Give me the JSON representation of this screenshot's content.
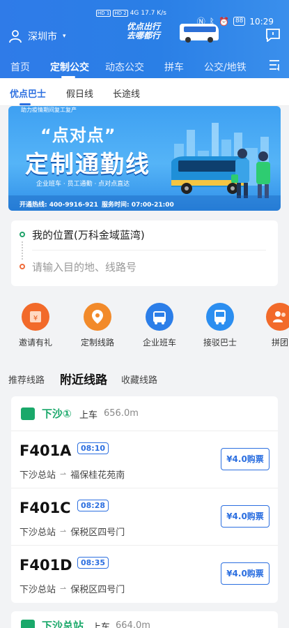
{
  "statusbar": {
    "sim1": "HD 1",
    "sim2": "HD 2",
    "net": "4G",
    "speed": "17.7 K/s",
    "battery": "88",
    "time": "10:29"
  },
  "header": {
    "city": "深圳市",
    "slogan_line1": "优点出行",
    "slogan_line2": "去哪都行"
  },
  "nav": {
    "tabs": [
      "首页",
      "定制公交",
      "动态公交",
      "拼车",
      "公交/地铁"
    ],
    "active": "定制公交"
  },
  "subtabs": {
    "items": [
      "优点巴士",
      "假日线",
      "长途线"
    ],
    "active": "优点巴士"
  },
  "hero": {
    "top_note": "助力疫情期间复工复产",
    "title1": "“点对点”",
    "title2": "定制通勤线",
    "tags": "企业班车 · 员工通勤 · 点对点直达",
    "hotline": "开通热线: 400-9916-921",
    "hours": "服务时间: 07:00-21:00"
  },
  "search": {
    "from": "我的位置(万科金域蓝湾)",
    "to_placeholder": "请输入目的地、线路号"
  },
  "quick": [
    {
      "label": "邀请有礼",
      "icon": "gift-icon",
      "color": "#f26a2a"
    },
    {
      "label": "定制线路",
      "icon": "map-pin-icon",
      "color": "#f28a2a"
    },
    {
      "label": "企业班车",
      "icon": "company-bus-icon",
      "color": "#2c7ee8"
    },
    {
      "label": "接驳巴士",
      "icon": "shuttle-bus-icon",
      "color": "#2c8ef0"
    },
    {
      "label": "拼团",
      "icon": "group-icon",
      "color": "#f26a2a"
    }
  ],
  "route_tabs": {
    "items": [
      "推荐线路",
      "附近线路",
      "收藏线路"
    ],
    "active": "附近线路"
  },
  "stop1": {
    "name": "下沙①",
    "board": "上车",
    "distance": "656.0m"
  },
  "routes": [
    {
      "no": "F401A",
      "time": "08:10",
      "from": "下沙总站",
      "to": "福保桂花苑南",
      "price": "¥4.0购票"
    },
    {
      "no": "F401C",
      "time": "08:28",
      "from": "下沙总站",
      "to": "保税区四号门",
      "price": "¥4.0购票"
    },
    {
      "no": "F401D",
      "time": "08:35",
      "from": "下沙总站",
      "to": "保税区四号门",
      "price": "¥4.0购票"
    }
  ],
  "stop2": {
    "name": "下沙总站",
    "board": "上车",
    "distance": "664.0m"
  },
  "colors": {
    "primary": "#2c6fe0",
    "green": "#1aa86a",
    "orange": "#f06b3a"
  }
}
